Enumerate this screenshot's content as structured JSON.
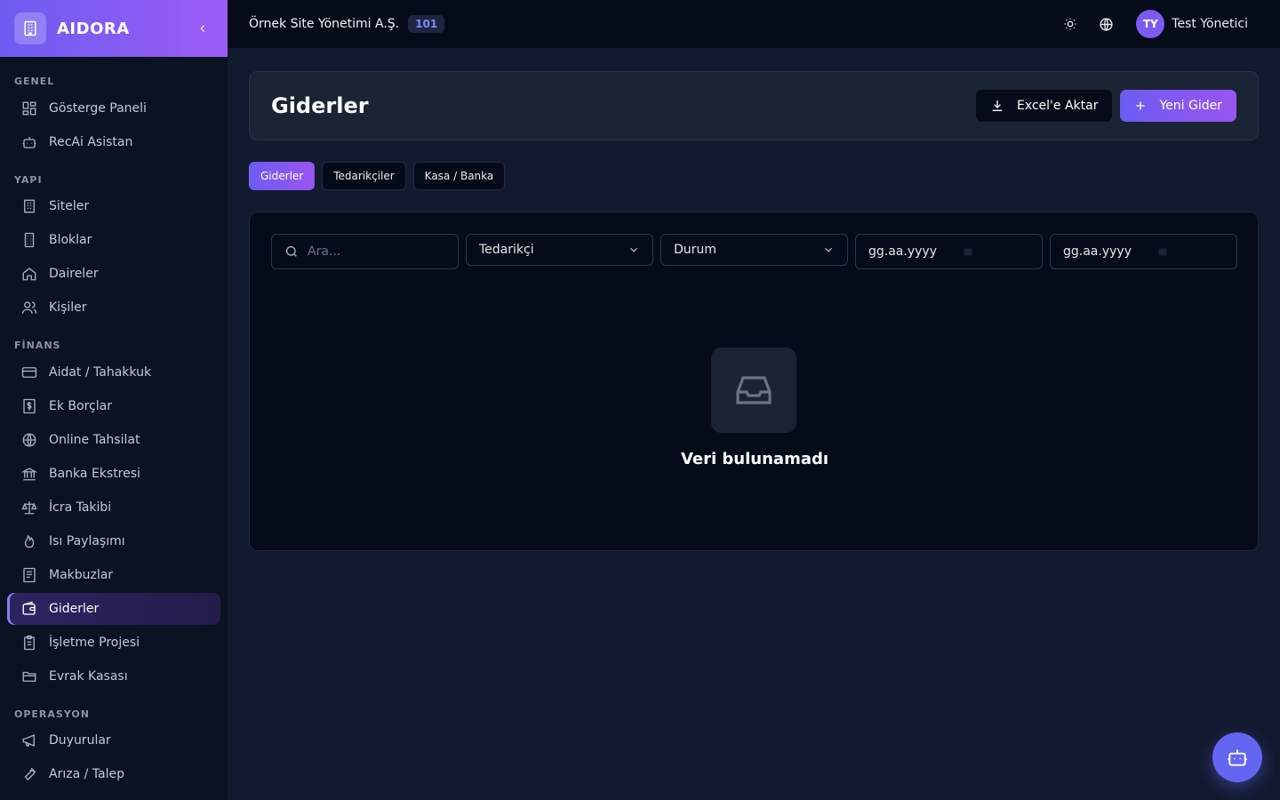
{
  "brand": {
    "name": "AIDORA"
  },
  "sidebar": {
    "sections": [
      {
        "title": "GENEL",
        "items": [
          {
            "label": "Gösterge Paneli",
            "icon": "dashboard-icon"
          },
          {
            "label": "RecAi Asistan",
            "icon": "bot-icon"
          }
        ]
      },
      {
        "title": "YAPI",
        "items": [
          {
            "label": "Siteler",
            "icon": "building-icon"
          },
          {
            "label": "Bloklar",
            "icon": "block-icon"
          },
          {
            "label": "Daireler",
            "icon": "home-icon"
          },
          {
            "label": "Kişiler",
            "icon": "users-icon"
          }
        ]
      },
      {
        "title": "FİNANS",
        "items": [
          {
            "label": "Aidat / Tahakkuk",
            "icon": "credit-card-icon"
          },
          {
            "label": "Ek Borçlar",
            "icon": "dollar-icon"
          },
          {
            "label": "Online Tahsilat",
            "icon": "globe-icon"
          },
          {
            "label": "Banka Ekstresi",
            "icon": "bank-icon"
          },
          {
            "label": "İcra Takibi",
            "icon": "scale-icon"
          },
          {
            "label": "Isı Paylaşımı",
            "icon": "flame-icon"
          },
          {
            "label": "Makbuzlar",
            "icon": "receipt-icon"
          },
          {
            "label": "Giderler",
            "icon": "wallet-icon",
            "active": true
          },
          {
            "label": "İşletme Projesi",
            "icon": "clipboard-icon"
          },
          {
            "label": "Evrak Kasası",
            "icon": "folder-icon"
          }
        ]
      },
      {
        "title": "OPERASYON",
        "items": [
          {
            "label": "Duyurular",
            "icon": "megaphone-icon"
          },
          {
            "label": "Arıza / Talep",
            "icon": "wrench-icon"
          }
        ]
      }
    ]
  },
  "topbar": {
    "org_name": "Örnek Site Yönetimi A.Ş.",
    "org_badge": "101",
    "user_initials": "TY",
    "user_name": "Test Yönetici"
  },
  "page": {
    "title": "Giderler",
    "export_label": "Excel'e Aktar",
    "new_label": "Yeni Gider"
  },
  "tabs": [
    {
      "label": "Giderler",
      "active": true
    },
    {
      "label": "Tedarikçiler",
      "active": false
    },
    {
      "label": "Kasa / Banka",
      "active": false
    }
  ],
  "filters": {
    "search_placeholder": "Ara...",
    "supplier_label": "Tedarikçi",
    "status_label": "Durum",
    "date_from_placeholder": "gg.aa.yyyy",
    "date_to_placeholder": "gg.aa.yyyy"
  },
  "empty": {
    "text": "Veri bulunamadı"
  },
  "colors": {
    "accent": "#6c5cf3",
    "accent2": "#9a55ef",
    "bg": "#111a2e"
  }
}
